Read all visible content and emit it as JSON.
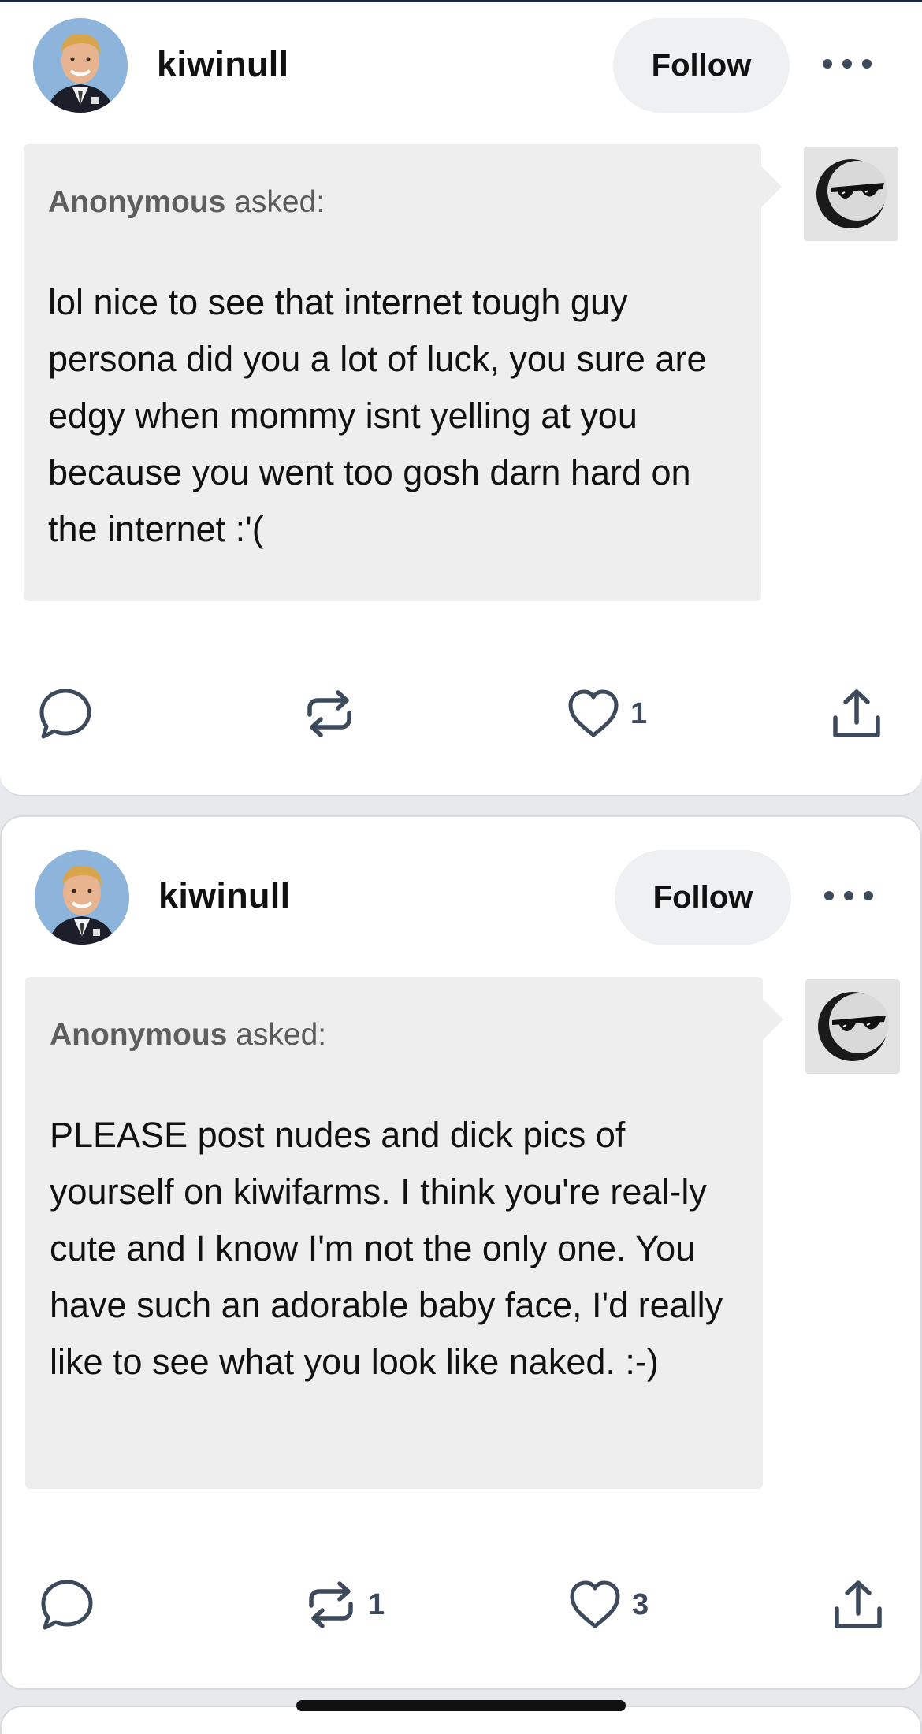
{
  "colors": {
    "background": "#e8e9ec",
    "card": "#ffffff",
    "ask_bubble": "#eeeeee",
    "follow_button_bg": "#eff0f2",
    "icon_color": "#3d4a5c"
  },
  "posts": [
    {
      "username": "kiwinull",
      "follow_label": "Follow",
      "more_icon": "ellipsis-icon",
      "asker_name": "Anonymous",
      "asker_suffix": "asked:",
      "question": "lol nice to see that internet tough guy persona did you a lot of luck, you sure are edgy when mommy isnt yelling at you because you went too gosh darn hard on the internet :'(",
      "actions": {
        "reply_icon": "speech-bubble-icon",
        "reblog_icon": "reblog-icon",
        "reblog_count": "",
        "like_icon": "heart-icon",
        "like_count": "1",
        "share_icon": "share-icon"
      }
    },
    {
      "username": "kiwinull",
      "follow_label": "Follow",
      "more_icon": "ellipsis-icon",
      "asker_name": "Anonymous",
      "asker_suffix": "asked:",
      "question": "PLEASE post nudes and dick pics of yourself on kiwifarms. I think you're real-ly cute and I know I'm not the only one. You have such an adorable baby face, I'd really like to see what you look like naked. :-)",
      "actions": {
        "reply_icon": "speech-bubble-icon",
        "reblog_icon": "reblog-icon",
        "reblog_count": "1",
        "like_icon": "heart-icon",
        "like_count": "3",
        "share_icon": "share-icon"
      }
    }
  ]
}
